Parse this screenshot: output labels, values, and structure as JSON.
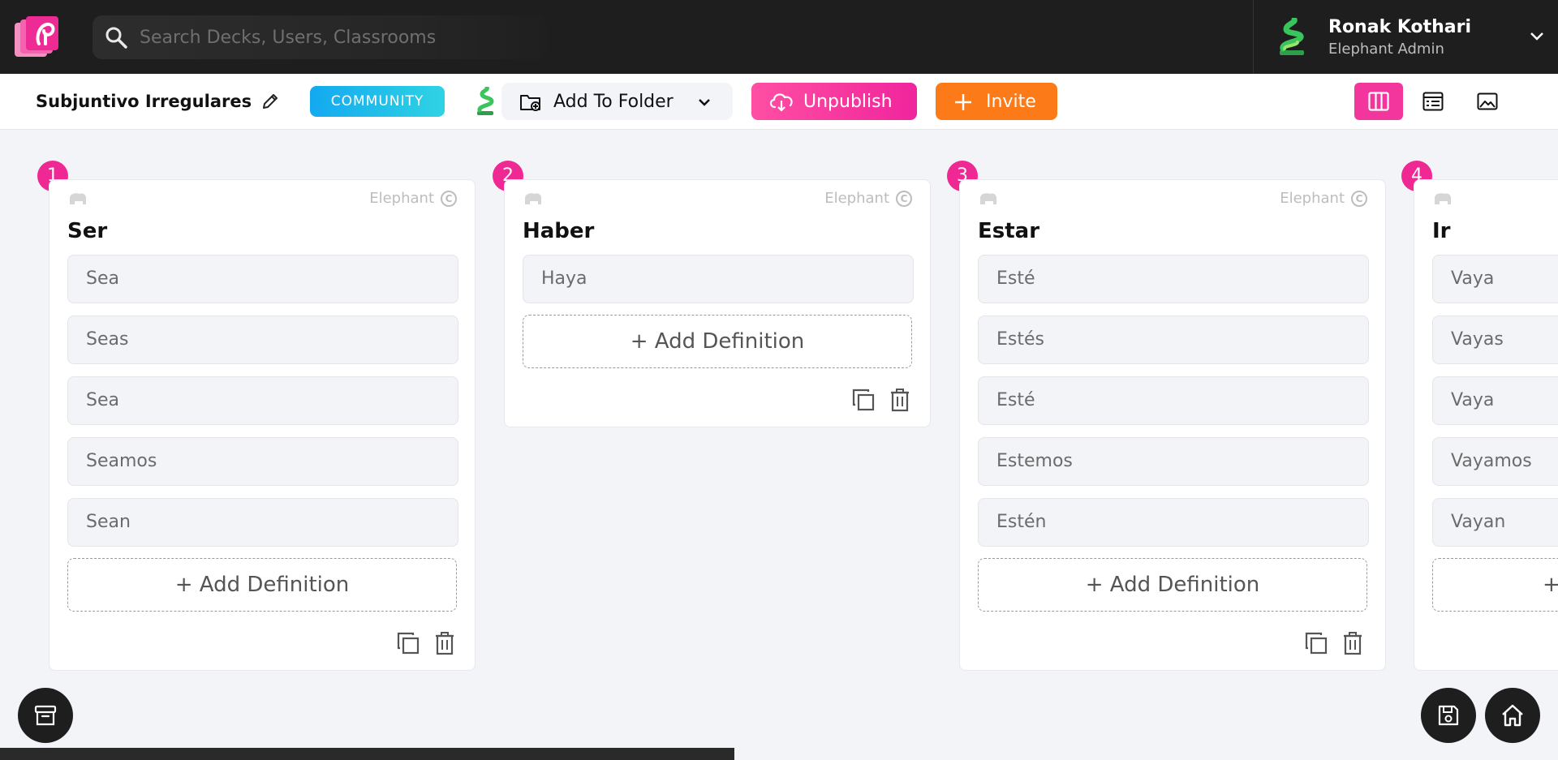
{
  "app": {
    "search_placeholder": "Search Decks, Users, Classrooms",
    "user": {
      "name": "Ronak Kothari",
      "role": "Elephant Admin"
    }
  },
  "toolbar": {
    "deck_title": "Subjuntivo Irregulares",
    "community_label": "COMMUNITY",
    "add_to_folder_label": "Add To Folder",
    "unpublish_label": "Unpublish",
    "invite_label": "Invite",
    "active_view": "columns"
  },
  "colors": {
    "accent_pink": "#f2369e",
    "community_blue": "#13a9f0",
    "invite_orange": "#fc7a17",
    "topbar": "#1e1e1e"
  },
  "cards": [
    {
      "number": "1",
      "credit": "Elephant",
      "title": "Ser",
      "definitions": [
        "Sea",
        "Seas",
        "Sea",
        "Seamos",
        "Sean"
      ],
      "add_label": "+ Add Definition"
    },
    {
      "number": "2",
      "credit": "Elephant",
      "title": "Haber",
      "definitions": [
        "Haya"
      ],
      "add_label": "+ Add Definition"
    },
    {
      "number": "3",
      "credit": "Elephant",
      "title": "Estar",
      "definitions": [
        "Esté",
        "Estés",
        "Esté",
        "Estemos",
        "Estén"
      ],
      "add_label": "+ Add Definition"
    },
    {
      "number": "4",
      "credit": "",
      "title": "Ir",
      "definitions": [
        "Vaya",
        "Vayas",
        "Vaya",
        "Vayamos",
        "Vayan"
      ],
      "add_label": "+"
    }
  ],
  "icons": {
    "search": "search-icon",
    "edit": "pencil-icon",
    "folder": "folder-plus-icon",
    "unpublish": "cloud-download-icon",
    "invite": "plus-icon",
    "view_columns": "columns-icon",
    "view_table": "table-icon",
    "view_image": "image-icon",
    "copy": "copy-icon",
    "delete": "trash-icon",
    "archive": "archive-icon",
    "save": "save-icon",
    "home": "home-icon"
  }
}
